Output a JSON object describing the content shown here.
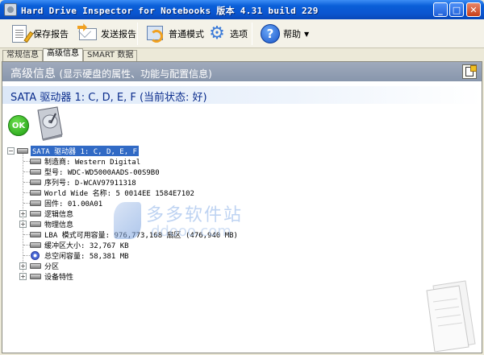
{
  "window": {
    "title": "Hard Drive Inspector for Notebooks 版本 4.31 build 229",
    "min_symbol": "_",
    "max_symbol": "□",
    "close_symbol": "✕"
  },
  "toolbar": {
    "save_label": "保存报告",
    "send_label": "发送报告",
    "mode_label": "普通模式",
    "options_label": "选项",
    "help_label": "帮助",
    "help_symbol": "?",
    "dropdown_symbol": "▼"
  },
  "tabs": [
    {
      "label": "常规信息",
      "active": false
    },
    {
      "label": "高级信息",
      "active": true
    },
    {
      "label": "SMART 数据",
      "active": false
    }
  ],
  "header": {
    "title": "高级信息",
    "subtitle": "(显示硬盘的属性、功能与配置信息)"
  },
  "drive": {
    "title": "SATA 驱动器 1: C, D, E, F (当前状态: 好)",
    "status": "OK"
  },
  "tree": {
    "root": "SATA 驱动器 1: C, D, E, F",
    "items": [
      {
        "text": "制造商: Western Digital"
      },
      {
        "text": "型号: WDC-WD5000AADS-00S9B0"
      },
      {
        "text": "序列号: D-WCAV97911318"
      },
      {
        "text": "World Wide 名称: 5 0014EE 1584E7102"
      },
      {
        "text": "固件: 01.00A01"
      },
      {
        "text": "逻辑信息"
      },
      {
        "text": "物理信息"
      },
      {
        "text": "LBA 模式可用容量: 976,773,168 扇区 (476,940 MB)"
      },
      {
        "text": "缓冲区大小: 32,767 KB"
      },
      {
        "text": "总空闲容量: 58,381 MB"
      },
      {
        "text": "分区"
      },
      {
        "text": "设备特性"
      }
    ],
    "expand_symbol": "+",
    "collapse_symbol": "−"
  },
  "watermark": {
    "cn": "多多软件站",
    "en": "ddooo.com"
  }
}
